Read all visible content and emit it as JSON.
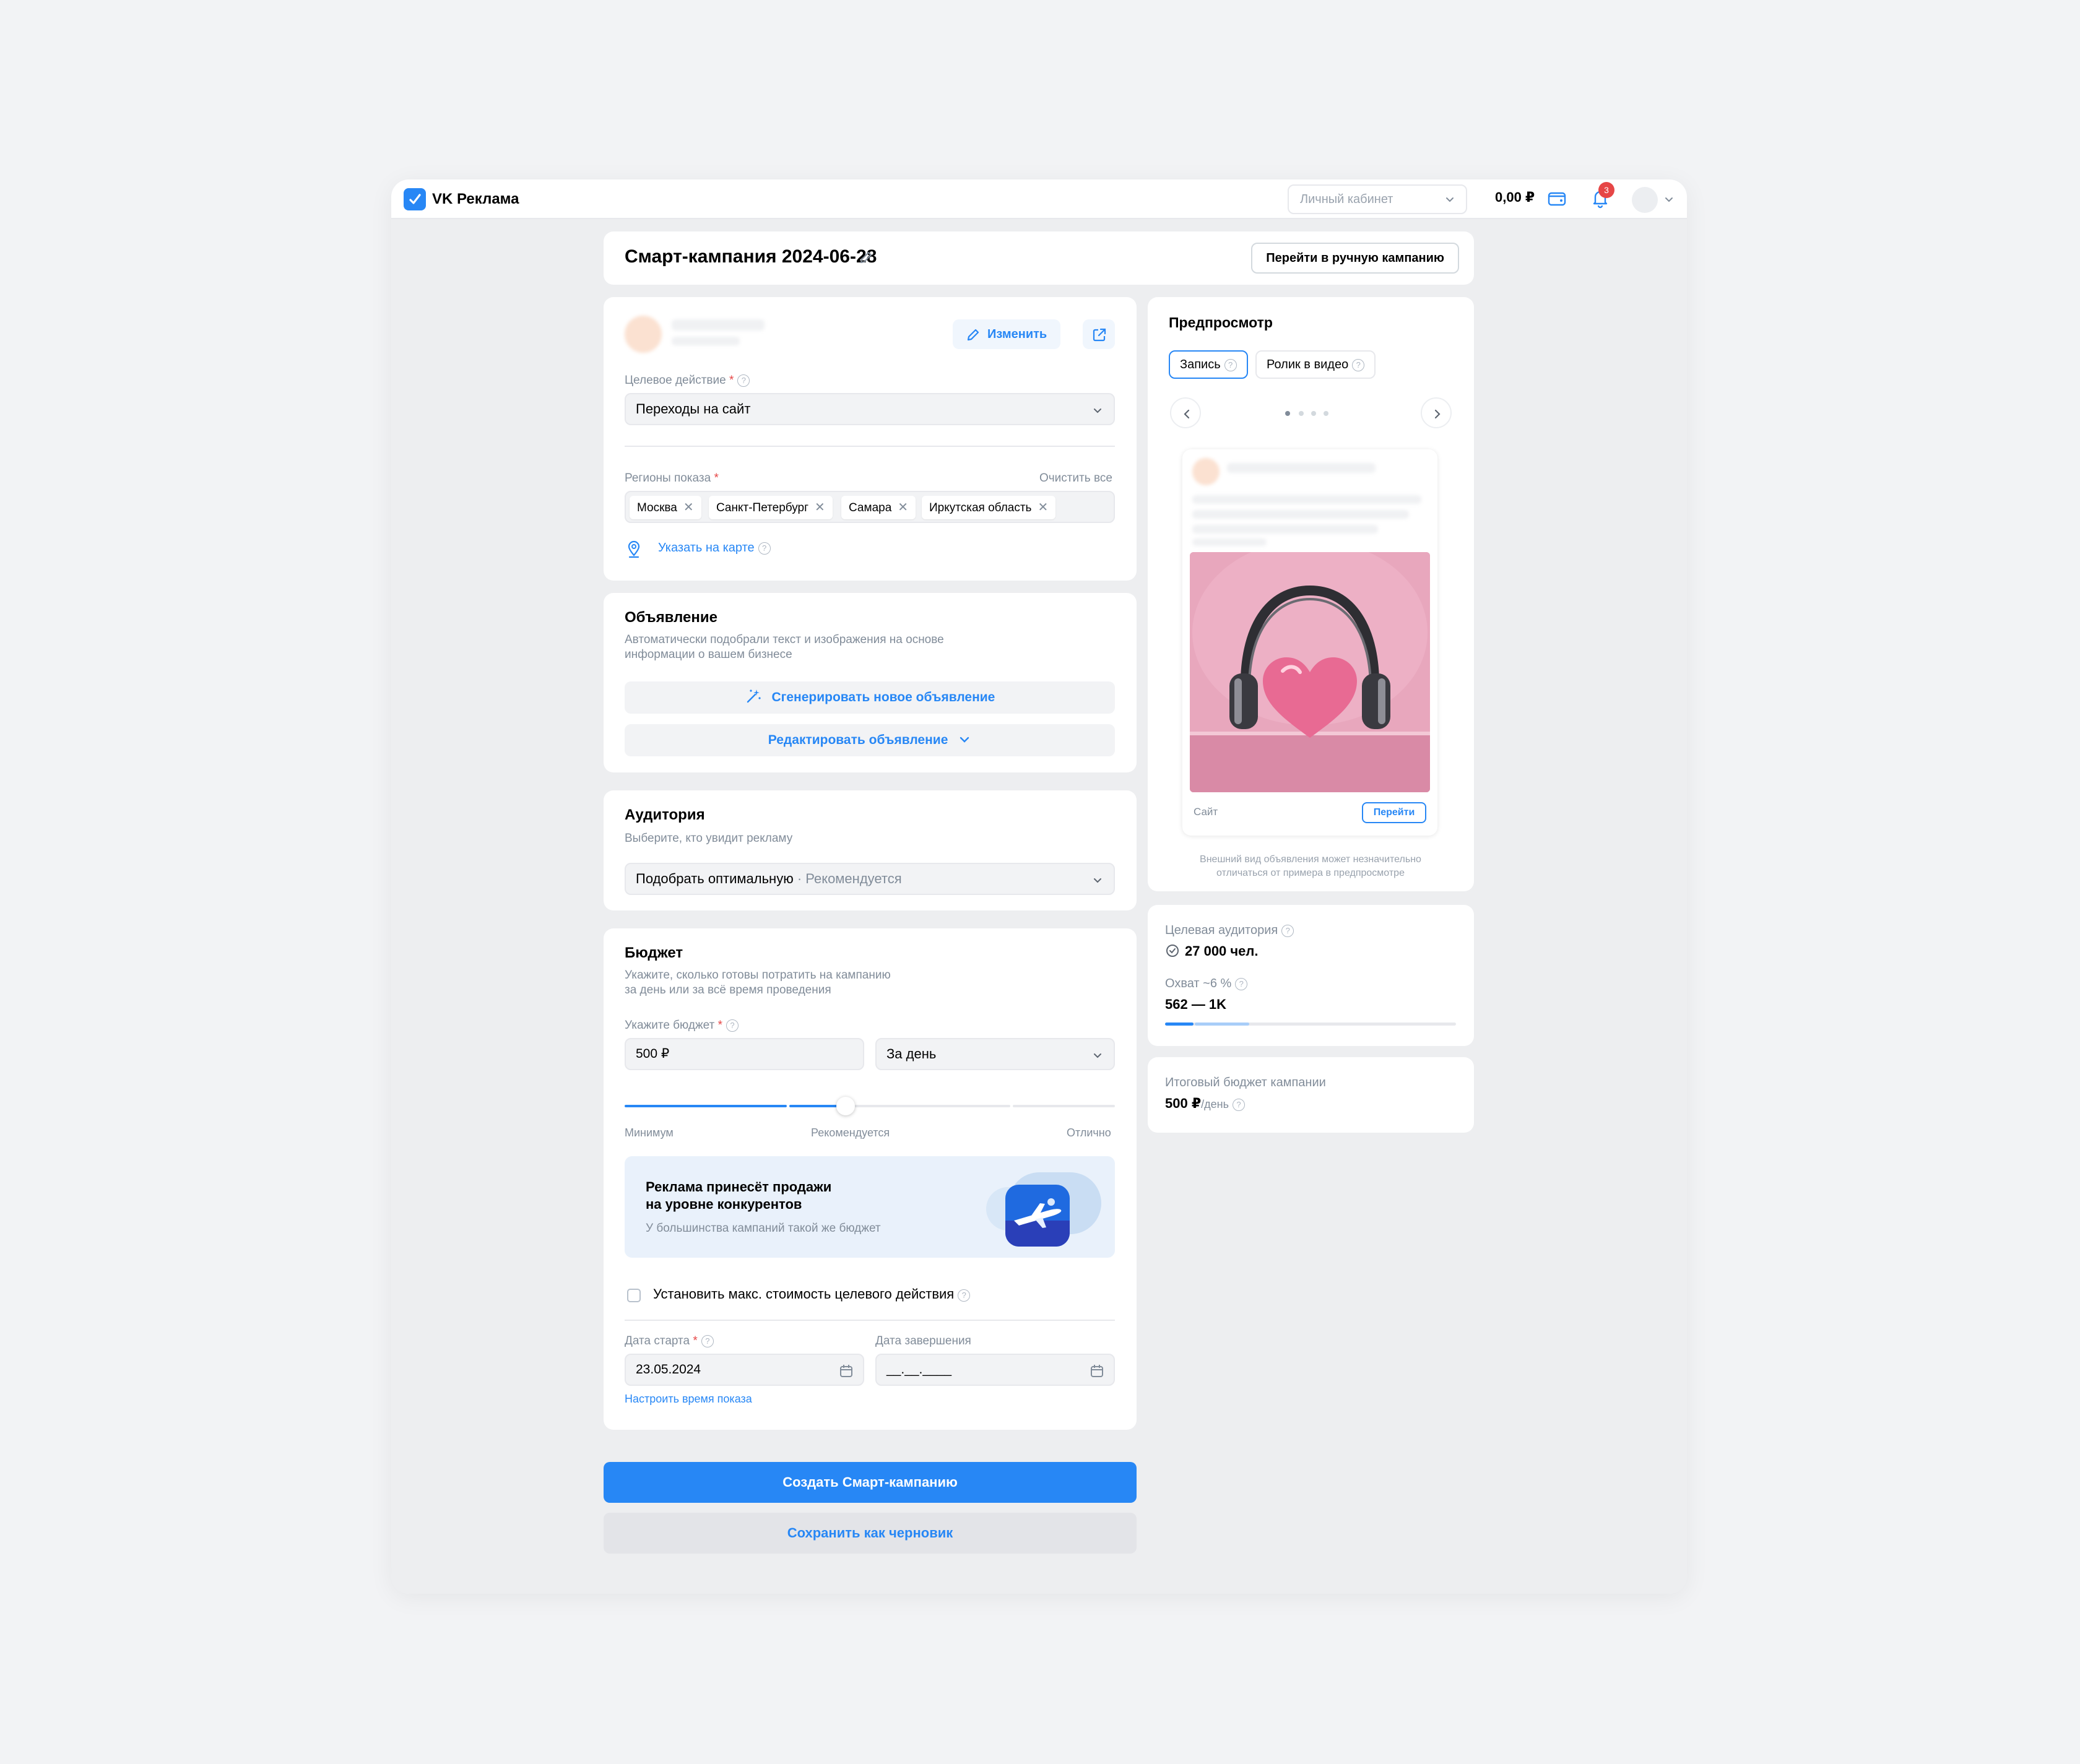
{
  "app": {
    "logo_text": "VK Реклама"
  },
  "header": {
    "cabinet_placeholder": "Личный кабинет",
    "balance": "0,00 ₽",
    "notifications_count": "3",
    "accent_color": "#2787f5",
    "badge_color": "#e64646"
  },
  "campaign": {
    "title": "Смарт-кампания 2024-06-28",
    "manual_button": "Перейти в ручную кампанию"
  },
  "setup": {
    "edit_button": "Изменить",
    "target_action_label": "Целевое действие",
    "target_action_value": "Переходы на сайт",
    "regions_label": "Регионы показа",
    "clear_all": "Очистить все",
    "regions": [
      "Москва",
      "Санкт-Петербург",
      "Самара",
      "Иркутская область"
    ],
    "map_link": "Указать на карте"
  },
  "ad": {
    "title": "Объявление",
    "subtitle_line1": "Автоматически подобрали текст и изображения на основе",
    "subtitle_line2": "информации о вашем бизнесе",
    "generate_button": "Сгенерировать новое объявление",
    "edit_button": "Редактировать объявление"
  },
  "audience": {
    "title": "Аудитория",
    "subtitle": "Выберите, кто увидит рекламу",
    "select_value": "Подобрать оптимальную",
    "select_hint": " · Рекомендуется"
  },
  "budget": {
    "title": "Бюджет",
    "subtitle_line1": "Укажите, сколько готовы потратить на кампанию",
    "subtitle_line2": "за день или за всё время проведения",
    "amount_label": "Укажите бюджет",
    "amount_value": "500 ₽",
    "period_value": "За день",
    "slider_level": 0.5,
    "slider_min": "Минимум",
    "slider_mid": "Рекомендуется",
    "slider_max": "Отлично",
    "banner_title_line1": "Реклама принесёт продажи",
    "banner_title_line2": "на уровне конкурентов",
    "banner_sub": "У большинства кампаний такой же бюджет",
    "max_cost_label": "Установить макс. стоимость целевого действия",
    "start_label": "Дата старта",
    "start_value": "23.05.2024",
    "end_label": "Дата завершения",
    "end_placeholder": "__.__.____",
    "schedule_link": "Настроить время показа"
  },
  "actions": {
    "create": "Создать Смарт-кампанию",
    "draft": "Сохранить как черновик"
  },
  "preview": {
    "title": "Предпросмотр",
    "tabs": [
      "Запись",
      "Ролик в видео"
    ],
    "site_label": "Сайт",
    "go_button": "Перейти",
    "disclaimer_line1": "Внешний вид объявления может незначительно",
    "disclaimer_line2": "отличаться от примера в предпросмотре"
  },
  "stats": {
    "audience_label": "Целевая аудитория",
    "audience_value": "27 000 чел.",
    "reach_label": "Охват ~6 %",
    "reach_value": "562 — 1K",
    "reach_fill": 0.29
  },
  "total": {
    "label": "Итоговый бюджет кампании",
    "value": "500 ₽",
    "unit": "/день"
  }
}
